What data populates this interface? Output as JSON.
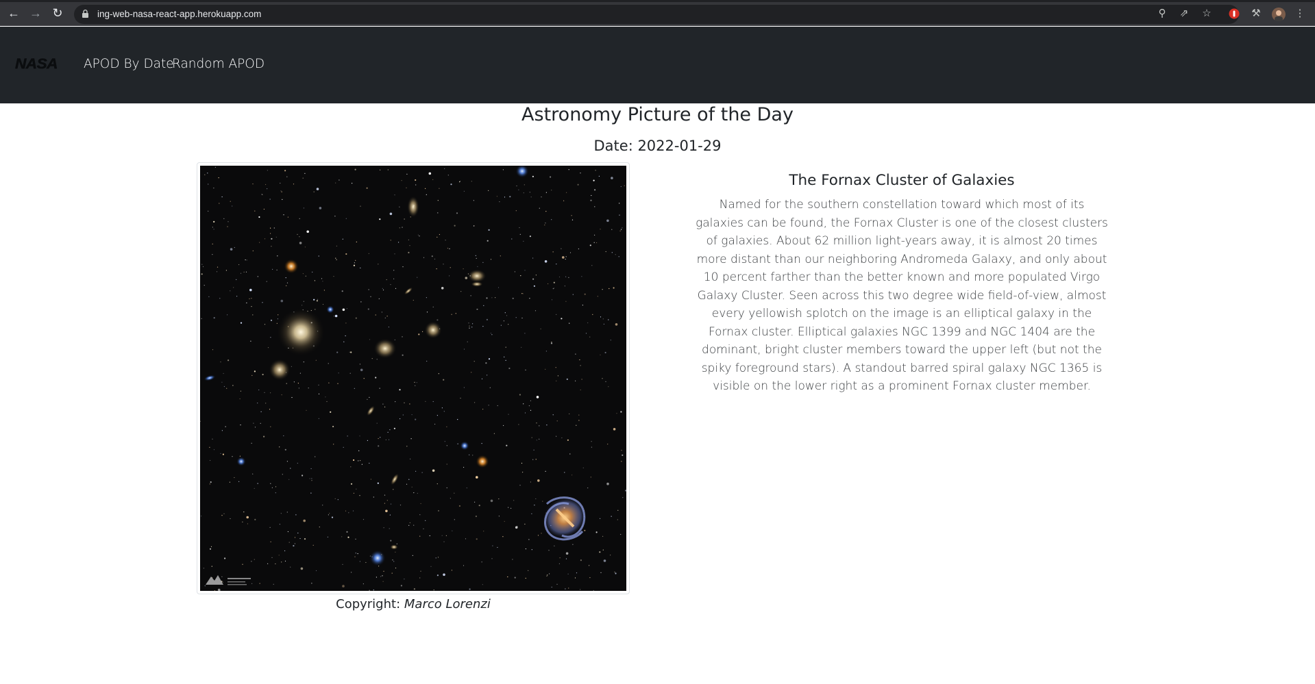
{
  "browser": {
    "url": "ing-web-nasa-react-app.herokuapp.com",
    "back_icon": "arrow-left-icon",
    "forward_icon": "arrow-right-icon",
    "reload_icon": "reload-icon"
  },
  "navbar": {
    "brand": "NASA",
    "links": [
      {
        "label": "APOD By Date"
      },
      {
        "label": "Random APOD"
      }
    ]
  },
  "page": {
    "title": "Astronomy Picture of the Day",
    "date_label": "Date:",
    "date_value": "2022-01-29",
    "date_line": "Date: 2022-01-29"
  },
  "apod": {
    "title": "The Fornax Cluster of Galaxies",
    "explanation": "Named for the southern constellation toward which most of its galaxies can be found, the Fornax Cluster is one of the closest clusters of galaxies. About 62 million light-years away, it is almost 20 times more distant than our neighboring Andromeda Galaxy, and only about 10 percent farther than the better known and more populated Virgo Galaxy Cluster. Seen across this two degree wide field-of-view, almost every yellowish splotch on the image is an elliptical galaxy in the Fornax cluster. Elliptical galaxies NGC 1399 and NGC 1404 are the dominant, bright cluster members toward the upper left (but not the spiky foreground stars). A standout barred spiral galaxy NGC 1365 is visible on the lower right as a prominent Fornax cluster member.",
    "copyright_label": "Copyright:",
    "copyright_name": "Marco Lorenzi"
  }
}
